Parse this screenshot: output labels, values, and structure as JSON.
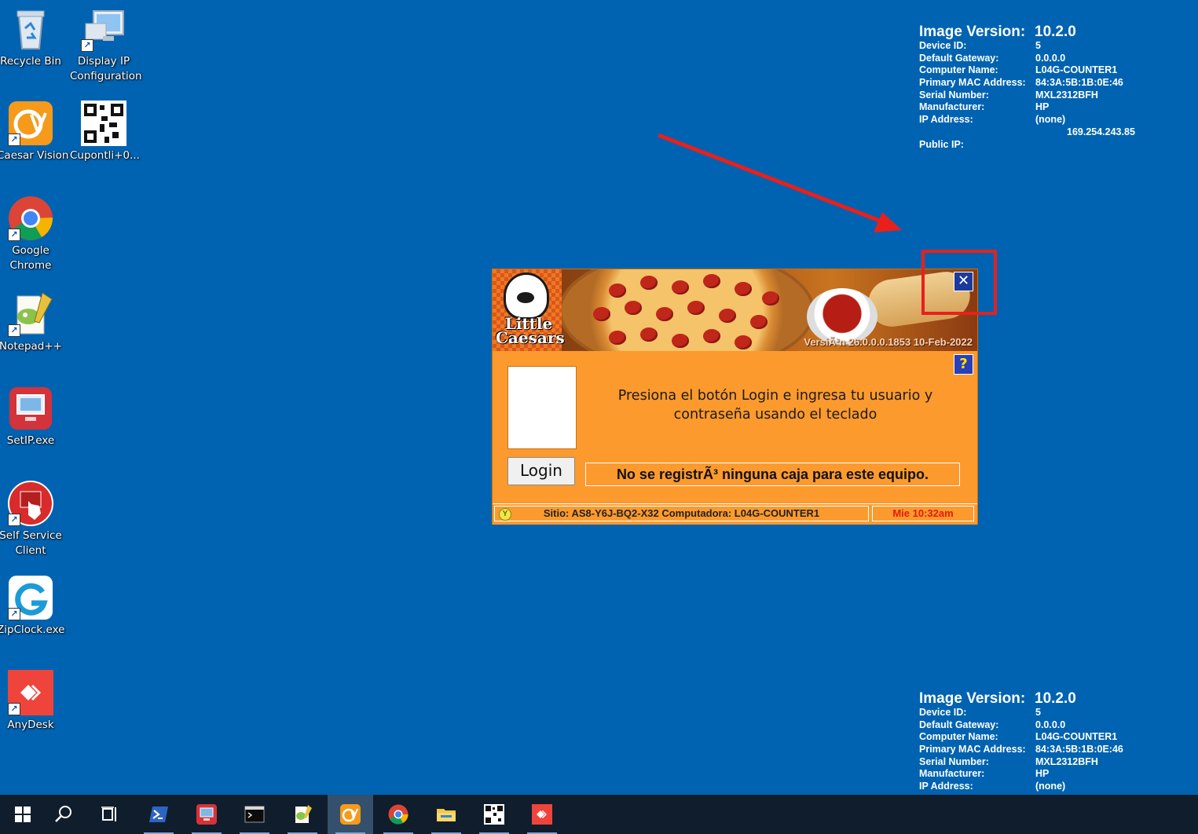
{
  "desktop_icons": [
    {
      "label": "Recycle Bin",
      "icon": "recycle-bin-icon"
    },
    {
      "label": "Display IP\nConfiguration",
      "icon": "display-ip-config-icon"
    },
    {
      "label": "Caesar Vision",
      "icon": "caesar-vision-icon"
    },
    {
      "label": "Cupontli+0...",
      "icon": "qr-code-icon"
    },
    {
      "label": "Google Chrome",
      "icon": "chrome-icon"
    },
    {
      "label": "Notepad++",
      "icon": "notepad-plus-icon"
    },
    {
      "label": "SetIP.exe",
      "icon": "setip-icon"
    },
    {
      "label": "Self Service Client",
      "icon": "self-service-icon"
    },
    {
      "label": "ZipClock.exe",
      "icon": "zipclock-icon"
    },
    {
      "label": "AnyDesk",
      "icon": "anydesk-icon"
    }
  ],
  "info_top": {
    "image_version_label": "Image Version:",
    "image_version": "10.2.0",
    "rows": [
      {
        "k": "Device ID:",
        "v": "5"
      },
      {
        "k": "Default Gateway:",
        "v": "0.0.0.0"
      },
      {
        "k": "Computer Name:",
        "v": "L04G-COUNTER1"
      },
      {
        "k": "Primary MAC Address:",
        "v": "84:3A:5B:1B:0E:46"
      },
      {
        "k": "Serial Number:",
        "v": "MXL2312BFH"
      },
      {
        "k": "Manufacturer:",
        "v": "HP"
      },
      {
        "k": "IP Address:",
        "v": "(none)"
      }
    ],
    "ip_extra": "169.254.243.85",
    "public_ip_label": "Public IP:"
  },
  "info_bottom": {
    "image_version_label": "Image Version:",
    "image_version": "10.2.0",
    "rows": [
      {
        "k": "Device ID:",
        "v": "5"
      },
      {
        "k": "Default Gateway:",
        "v": "0.0.0.0"
      },
      {
        "k": "Computer Name:",
        "v": "L04G-COUNTER1"
      },
      {
        "k": "Primary MAC Address:",
        "v": "84:3A:5B:1B:0E:46"
      },
      {
        "k": "Serial Number:",
        "v": "MXL2312BFH"
      },
      {
        "k": "Manufacturer:",
        "v": "HP"
      },
      {
        "k": "IP Address:",
        "v": "(none)"
      }
    ]
  },
  "app": {
    "logo_text_1": "Little",
    "logo_text_2": "Caesars",
    "version": "VersiÃ³n 26.0.0.0.1853 10-Feb-2022",
    "close_label": "✕",
    "help_label": "?",
    "message": "Presiona el botón Login e ingresa tu usuario y contraseña usando el teclado",
    "login_label": "Login",
    "register_status": "No se registrÃ³ ninguna caja para este equipo.",
    "status_site": "Sitio: AS8-Y6J-BQ2-X32 Computadora: L04G-COUNTER1",
    "status_time": "Mie 10:32am",
    "status_dot": "Y"
  },
  "taskbar": [
    {
      "name": "start-button",
      "icon": "windows-icon"
    },
    {
      "name": "search-button",
      "icon": "search-icon"
    },
    {
      "name": "task-view-button",
      "icon": "task-view-icon"
    },
    {
      "name": "taskbar-powershell",
      "icon": "powershell-icon"
    },
    {
      "name": "taskbar-setip",
      "icon": "setip-icon"
    },
    {
      "name": "taskbar-terminal",
      "icon": "terminal-icon"
    },
    {
      "name": "taskbar-notepad",
      "icon": "notepad-plus-icon"
    },
    {
      "name": "taskbar-caesar-vision",
      "icon": "caesar-vision-icon"
    },
    {
      "name": "taskbar-chrome",
      "icon": "chrome-icon"
    },
    {
      "name": "taskbar-file-explorer",
      "icon": "folder-icon"
    },
    {
      "name": "taskbar-qr-app",
      "icon": "qr-code-icon"
    },
    {
      "name": "taskbar-anydesk",
      "icon": "anydesk-icon"
    }
  ],
  "colors": {
    "desktop": "#0063b1",
    "app_orange": "#fc9a2d",
    "annotation_red": "#e8201c",
    "taskbar": "#101d2c"
  }
}
